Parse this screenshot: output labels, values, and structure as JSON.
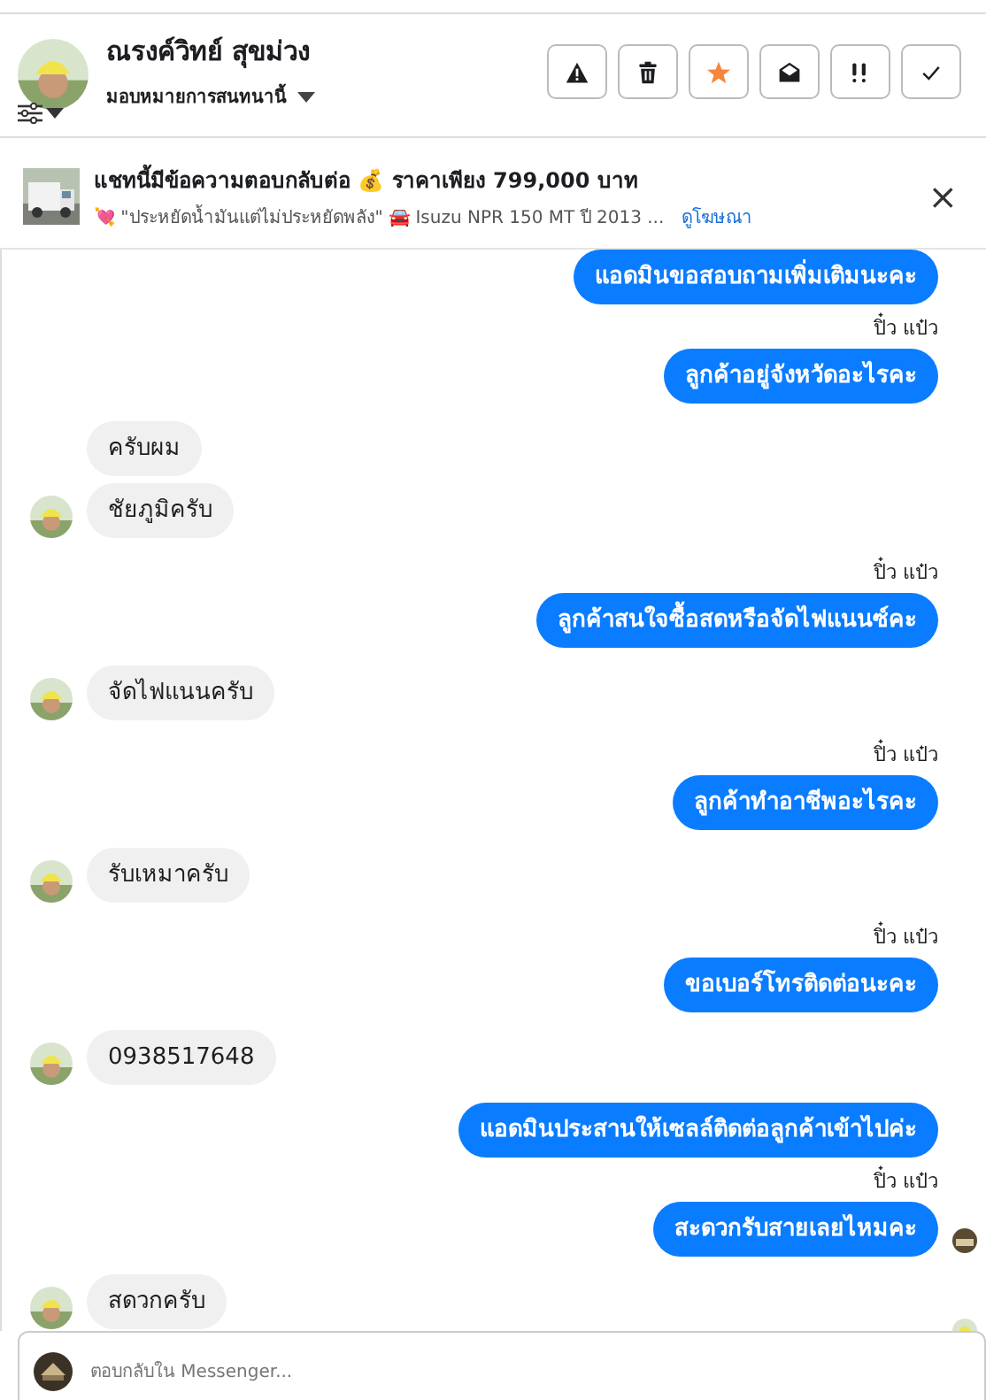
{
  "header": {
    "name": "ณรงค์วิทย์ สุขม่วง",
    "assign": "มอบหมายการสนทนานี้",
    "actions": [
      {
        "kind": "warning"
      },
      {
        "kind": "trash"
      },
      {
        "kind": "star",
        "on": true
      },
      {
        "kind": "envelope"
      },
      {
        "kind": "important"
      },
      {
        "kind": "check"
      }
    ]
  },
  "banner": {
    "title": "แชทนี้มีข้อความตอบกลับต่อ 💰 ราคาเพียง 799,000 บาท",
    "subtitle": "💘 \"ประหยัดน้ำมันแต่ไม่ประหยัดพลัง\" 🚘 Isuzu NPR 150 MT ปี 2013 ...",
    "link": "ดูโฆษณา",
    "close": "×"
  },
  "messages": [
    {
      "kind": "sent",
      "text": "แอดมินขอสอบถามเพิ่มเติมนะคะ"
    },
    {
      "kind": "sent",
      "sender": "ปิ๋ว แป๋ว",
      "text": "ลูกค้าอยู่จังหวัดอะไรคะ"
    },
    {
      "kind": "received",
      "text": "ครับผม",
      "avatar": false
    },
    {
      "kind": "received",
      "text": "ชัยภูมิครับ",
      "avatar": true
    },
    {
      "kind": "sent",
      "sender": "ปิ๋ว แป๋ว",
      "text": "ลูกค้าสนใจซื้อสดหรือจัดไฟแนนซ์คะ"
    },
    {
      "kind": "received",
      "text": "จัดไฟแนนครับ",
      "avatar": true
    },
    {
      "kind": "sent",
      "sender": "ปิ๋ว แป๋ว",
      "text": "ลูกค้าทำอาชีพอะไรคะ"
    },
    {
      "kind": "received",
      "text": "รับเหมาครับ",
      "avatar": true
    },
    {
      "kind": "sent",
      "sender": "ปิ๋ว แป๋ว",
      "text": "ขอเบอร์โทรติดต่อนะคะ"
    },
    {
      "kind": "received",
      "text": "0938517648",
      "avatar": true
    },
    {
      "kind": "sent",
      "text": "แอดมินประสานให้เซลล์ติดต่อลูกค้าเข้าไปค่ะ"
    },
    {
      "kind": "sent",
      "sender": "ปิ๋ว แป๋ว",
      "text": "สะดวกรับสายเลยไหมคะ",
      "seen": true
    },
    {
      "kind": "received",
      "text": "สดวกครับ",
      "avatar": true,
      "seen": true
    }
  ],
  "composer": {
    "placeholder": "ตอบกลับใน Messenger..."
  }
}
